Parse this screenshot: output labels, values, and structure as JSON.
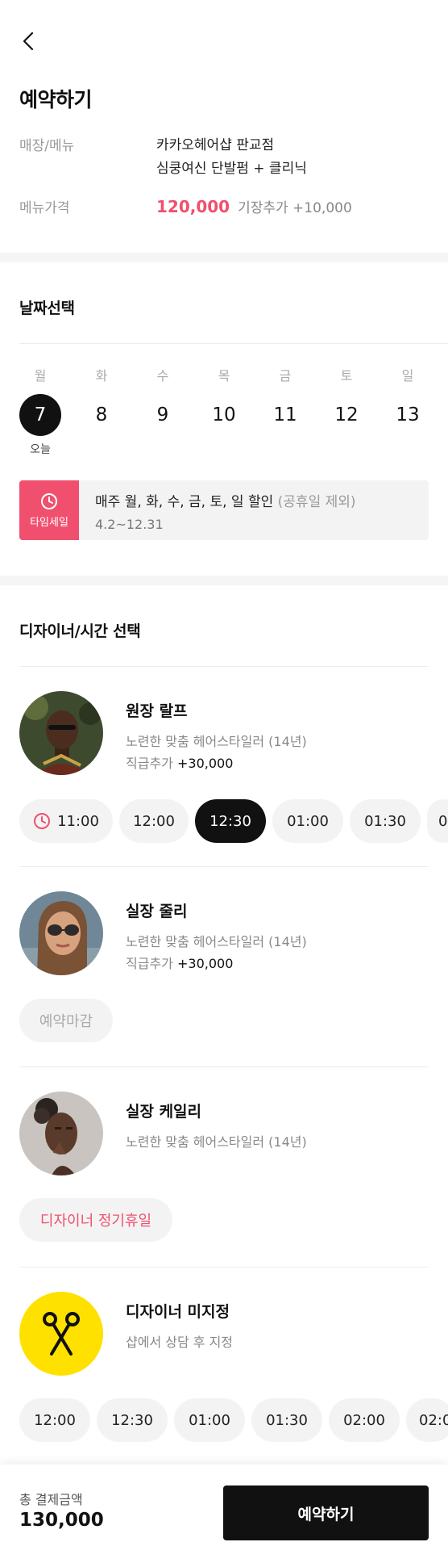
{
  "page": {
    "title": "예약하기"
  },
  "info": {
    "shop_label": "매장/메뉴",
    "shop_name": "카카오헤어샵 판교점",
    "menu_name": "심쿵여신 단발펌 + 클리닉",
    "price_label": "메뉴가격",
    "price": "120,000",
    "price_extra": "기장추가 +10,000"
  },
  "date_section": {
    "title": "날짜선택",
    "days": [
      {
        "name": "월",
        "num": "7",
        "today": "오늘",
        "selected": true
      },
      {
        "name": "화",
        "num": "8"
      },
      {
        "name": "수",
        "num": "9"
      },
      {
        "name": "목",
        "num": "10"
      },
      {
        "name": "금",
        "num": "11"
      },
      {
        "name": "토",
        "num": "12"
      },
      {
        "name": "일",
        "num": "13"
      }
    ],
    "sale": {
      "badge": "타임세일",
      "main": "매주 월, 화, 수, 금, 토, 일 할인",
      "sub": "(공휴일 제외)",
      "period": "4.2~12.31"
    }
  },
  "designer_section": {
    "title": "디자이너/시간 선택",
    "designers": [
      {
        "name": "원장 랄프",
        "desc": "노련한 맞춤 헤어스타일러 (14년)",
        "extra_label": "직급추가",
        "extra_value": "+30,000",
        "times": [
          "11:00",
          "12:00",
          "12:30",
          "01:00",
          "01:30",
          "0"
        ],
        "selected_time": "12:30"
      },
      {
        "name": "실장 줄리",
        "desc": "노련한 맞춤 헤어스타일러 (14년)",
        "extra_label": "직급추가",
        "extra_value": "+30,000",
        "status": "예약마감"
      },
      {
        "name": "실장 케일리",
        "desc": "노련한 맞춤 헤어스타일러 (14년)",
        "status": "디자이너 정기휴일"
      },
      {
        "name": "디자이너 미지정",
        "desc": "샵에서 상담 후 지정",
        "times": [
          "12:00",
          "12:30",
          "01:00",
          "01:30",
          "02:00",
          "02:0"
        ]
      }
    ]
  },
  "footer": {
    "total_label": "총 결제금액",
    "total_amount": "130,000",
    "reserve_label": "예약하기"
  },
  "colors": {
    "accent": "#f0506e",
    "primary": "#111111",
    "designer_unassigned_bg": "#ffe100"
  },
  "icons": [
    "back-arrow-icon",
    "clock-icon",
    "scissors-icon"
  ]
}
